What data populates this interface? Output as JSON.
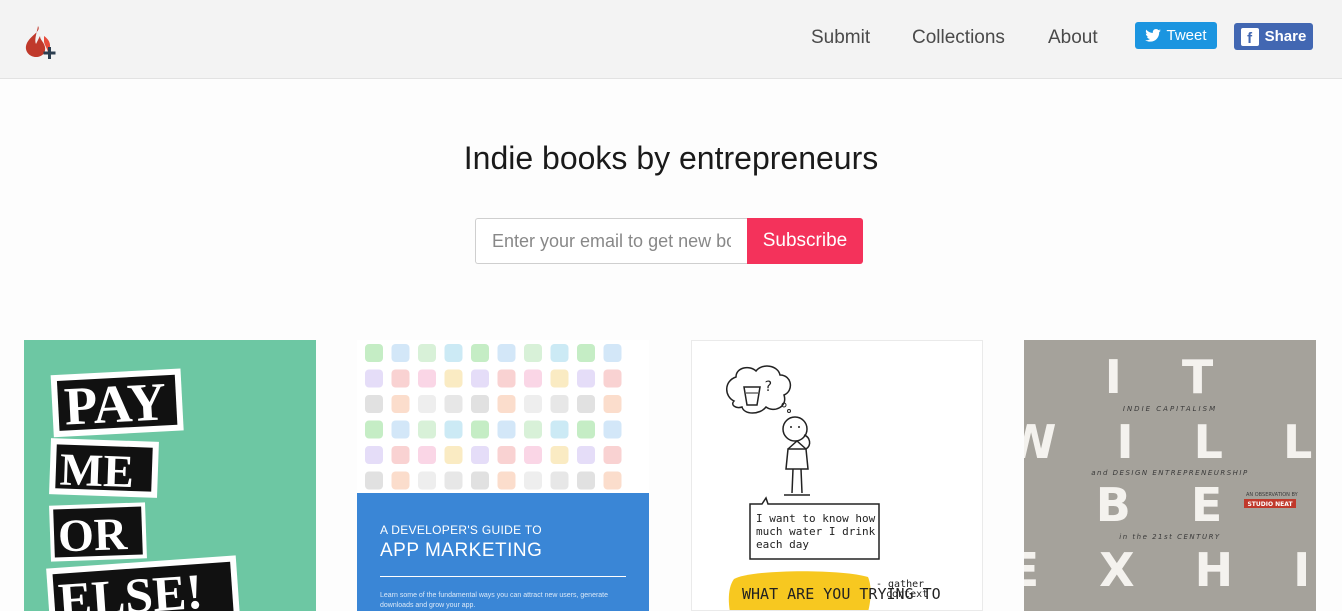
{
  "header": {
    "nav": [
      "Submit",
      "Collections",
      "About"
    ],
    "tweet_label": "Tweet",
    "share_label": "Share"
  },
  "hero": {
    "title": "Indie books by entrepreneurs",
    "email_placeholder": "Enter your email to get new books",
    "subscribe_label": "Subscribe"
  },
  "books": [
    {
      "cover_lines": [
        "PAY",
        "ME",
        "OR",
        "ELSE!"
      ]
    },
    {
      "eyebrow": "A DEVELOPER'S GUIDE TO",
      "title": "APP MARKETING",
      "blurb": "Learn some of the fundamental ways you can attract new users, generate downloads and grow your app."
    },
    {
      "speech": [
        "I want to know how",
        "much water I drink",
        "each day"
      ],
      "caption": "WHAT ARE YOU TRYING TO",
      "aside": [
        "- gather",
        "context"
      ]
    },
    {
      "big_rows": [
        "I T",
        "W I L L",
        "B E",
        "E X H I"
      ],
      "small_1": "INDIE CAPITALISM",
      "small_2": "and DESIGN ENTREPRENEURSHIP",
      "small_3": "in the 21st CENTURY",
      "publisher_note": "AN OBSERVATION BY",
      "publisher": "STUDIO NEAT"
    }
  ],
  "colors": {
    "accent": "#f4325b",
    "twitter": "#1b95e0",
    "facebook": "#4267b2",
    "logo_red": "#c0392b"
  }
}
